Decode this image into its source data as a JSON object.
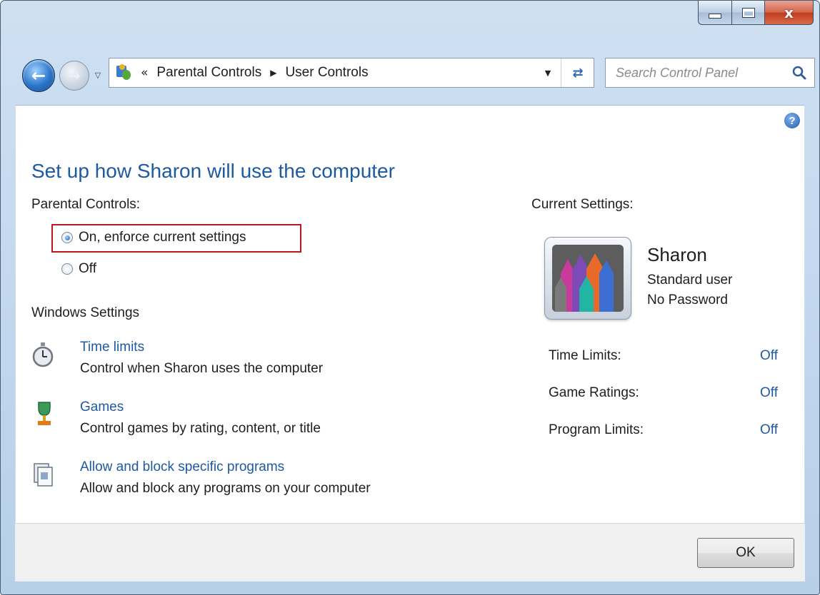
{
  "window": {
    "caption_minimize": "minimize",
    "caption_maximize": "maximize",
    "caption_close": "x"
  },
  "nav": {
    "back_icon": "back-arrow-icon",
    "forward_icon": "forward-arrow-icon",
    "breadcrumb_prefix": "«",
    "breadcrumbs": [
      "Parental Controls",
      "User Controls"
    ],
    "search_placeholder": "Search Control Panel"
  },
  "page": {
    "title": "Set up how Sharon will use the computer",
    "parental_controls_label": "Parental Controls:",
    "radio_on_label": "On, enforce current settings",
    "radio_off_label": "Off",
    "radio_on_checked": true,
    "windows_settings_label": "Windows Settings",
    "settings": [
      {
        "icon": "stopwatch-icon",
        "title": "Time limits",
        "description": "Control when Sharon uses the computer"
      },
      {
        "icon": "trophy-icon",
        "title": "Games",
        "description": "Control games by rating, content, or title"
      },
      {
        "icon": "programs-icon",
        "title": "Allow and block specific programs",
        "description": "Allow and block any programs on your computer"
      }
    ]
  },
  "current": {
    "label": "Current Settings:",
    "user_name": "Sharon",
    "user_type": "Standard user",
    "password_status": "No Password",
    "rows": [
      {
        "label": "Time Limits:",
        "value": "Off"
      },
      {
        "label": "Game Ratings:",
        "value": "Off"
      },
      {
        "label": "Program Limits:",
        "value": "Off"
      }
    ]
  },
  "footer": {
    "ok_label": "OK"
  },
  "colors": {
    "link": "#1e5aa0",
    "highlight": "#c0171c",
    "title": "#1e5aa0"
  }
}
